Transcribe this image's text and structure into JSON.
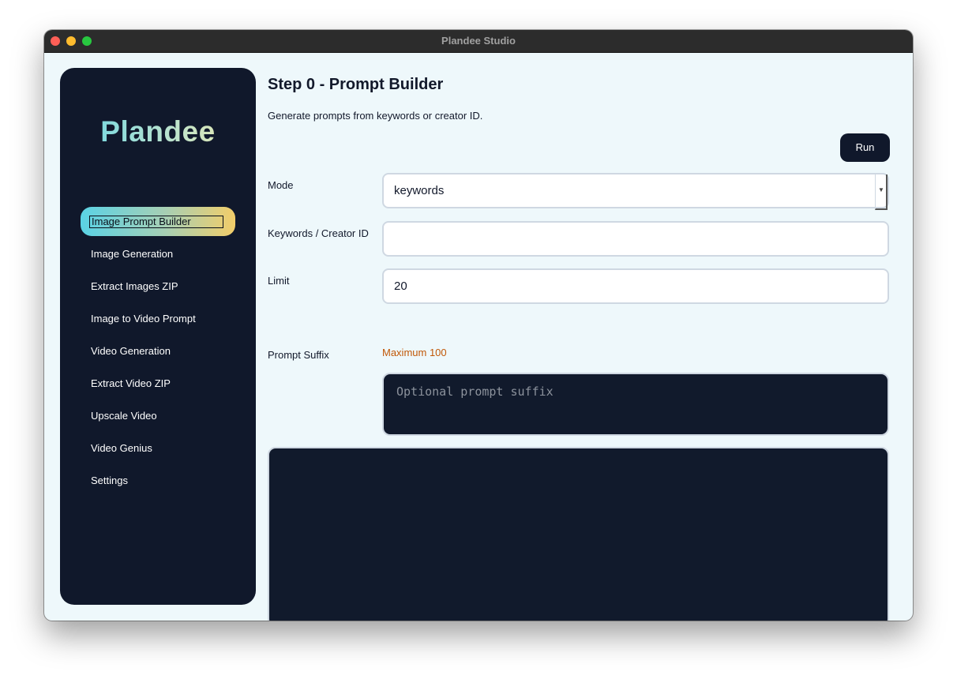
{
  "window": {
    "title": "Plandee Studio",
    "traffic_lights": [
      {
        "name": "close",
        "color": "#fe5f57"
      },
      {
        "name": "minimize",
        "color": "#febc2e"
      },
      {
        "name": "zoom",
        "color": "#28c840"
      }
    ]
  },
  "sidebar": {
    "logo": "Plandee",
    "active_index": 0,
    "items": [
      {
        "label": "Image Prompt Builder"
      },
      {
        "label": "Image Generation"
      },
      {
        "label": "Extract Images ZIP"
      },
      {
        "label": "Image to Video Prompt"
      },
      {
        "label": "Video Generation"
      },
      {
        "label": "Extract Video ZIP"
      },
      {
        "label": "Upscale Video"
      },
      {
        "label": "Video Genius"
      },
      {
        "label": "Settings"
      }
    ]
  },
  "main": {
    "title": "Step 0 - Prompt Builder",
    "description": "Generate prompts from keywords or creator ID.",
    "run_label": "Run",
    "fields": {
      "mode": {
        "label": "Mode",
        "value": "keywords"
      },
      "keywords": {
        "label": "Keywords / Creator ID",
        "value": ""
      },
      "limit": {
        "label": "Limit",
        "value": "20",
        "hint": "Maximum 100"
      },
      "suffix": {
        "label": "Prompt Suffix",
        "placeholder": "Optional prompt suffix"
      }
    },
    "output": ""
  },
  "colors": {
    "sidebar_bg": "#10182b",
    "page_bg": "#eef8fb",
    "hint": "#c15808",
    "accent_gradient": [
      "#5ad2e5",
      "#f2cd69"
    ]
  }
}
